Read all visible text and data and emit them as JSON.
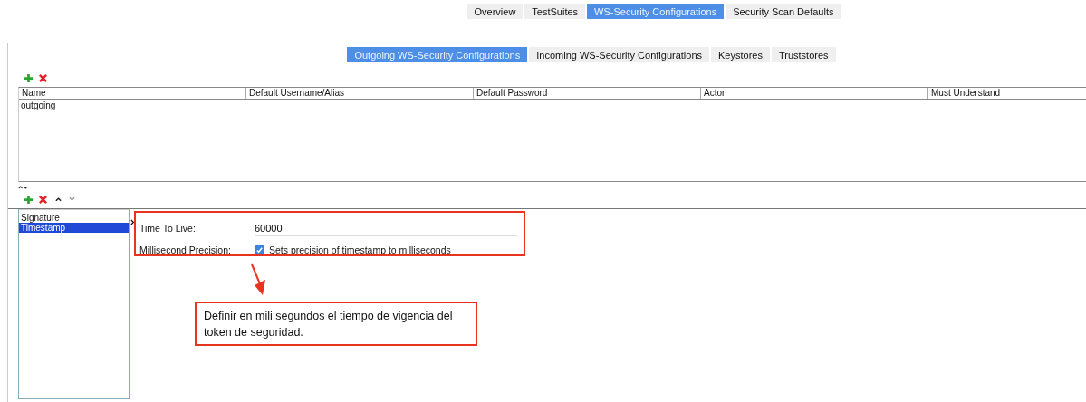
{
  "main_tabs": [
    {
      "label": "Overview",
      "selected": false
    },
    {
      "label": "TestSuites",
      "selected": false
    },
    {
      "label": "WS-Security Configurations",
      "selected": true
    },
    {
      "label": "Security Scan Defaults",
      "selected": false
    }
  ],
  "sub_tabs": [
    {
      "label": "Outgoing WS-Security Configurations",
      "selected": true
    },
    {
      "label": "Incoming WS-Security Configurations",
      "selected": false
    },
    {
      "label": "Keystores",
      "selected": false
    },
    {
      "label": "Truststores",
      "selected": false
    }
  ],
  "table": {
    "columns": [
      "Name",
      "Default Username/Alias",
      "Default Password",
      "Actor",
      "Must Understand"
    ],
    "rows": [
      [
        "outgoing"
      ]
    ]
  },
  "entries": [
    {
      "label": "Signature",
      "selected": false
    },
    {
      "label": "Timestamp",
      "selected": true
    }
  ],
  "form": {
    "time_to_live": {
      "label": "Time To Live:",
      "value": "60000"
    },
    "precision": {
      "label": "Millisecond Precision:",
      "checked": true,
      "text": "Sets precision of timestamp to milliseconds"
    }
  },
  "annotation": "Definir en mili segundos el tiempo de vigencia del token de seguridad."
}
